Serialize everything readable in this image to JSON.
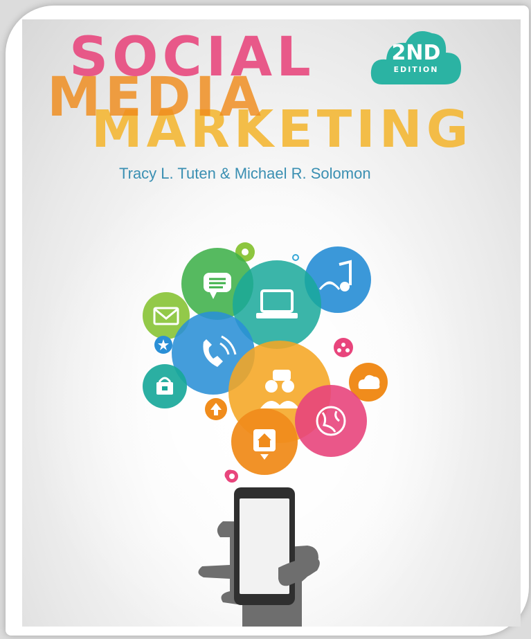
{
  "book": {
    "title_line1": "SOCIAL",
    "title_line2": "MEDIA",
    "title_line3": "MARKETING",
    "edition_number": "2ND",
    "edition_word": "EDITION",
    "authors": "Tracy L. Tuten & Michael R. Solomon"
  },
  "colors": {
    "social": "#e8457c",
    "media": "#f08c1c",
    "marketing": "#f4b93a",
    "edition_badge": "#2bb3a3",
    "authors": "#3a8fb2",
    "hand": "#6e6e6e",
    "phone": "#2f2f2f"
  },
  "icons": [
    "envelope-icon",
    "chat-icon",
    "laptop-icon",
    "music-note-icon",
    "phone-call-icon",
    "people-icon",
    "cloud-icon",
    "shopping-basket-icon",
    "globe-icon",
    "home-icon",
    "upload-icon",
    "star-icon",
    "share-icon",
    "location-icon",
    "gear-icon",
    "smartphone-icon",
    "hand-icon"
  ]
}
